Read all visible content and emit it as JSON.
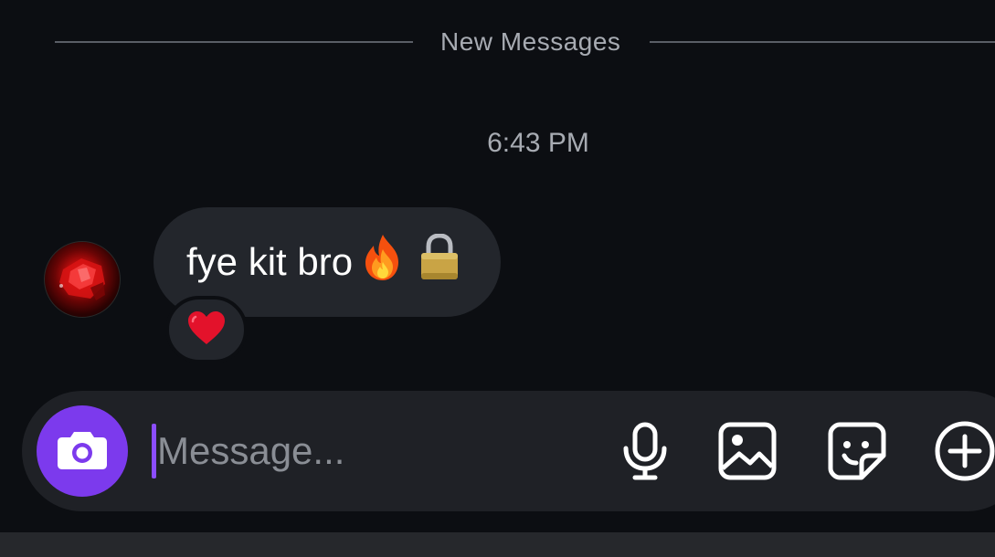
{
  "divider": {
    "label": "New Messages"
  },
  "timestamp": "6:43 PM",
  "message": {
    "text": "fye kit bro",
    "emojis": [
      "fire-emoji",
      "lock-emoji"
    ],
    "reaction": "heart-emoji"
  },
  "composer": {
    "placeholder": "Message...",
    "value": "",
    "camera_icon": "camera-icon",
    "tools": [
      "microphone-icon",
      "image-icon",
      "sticker-icon",
      "plus-icon"
    ]
  },
  "colors": {
    "background": "#0c0e12",
    "bubble": "#23262c",
    "composer": "#1f2126",
    "accent": "#7c3aed",
    "muted_text": "#a7abb2"
  }
}
